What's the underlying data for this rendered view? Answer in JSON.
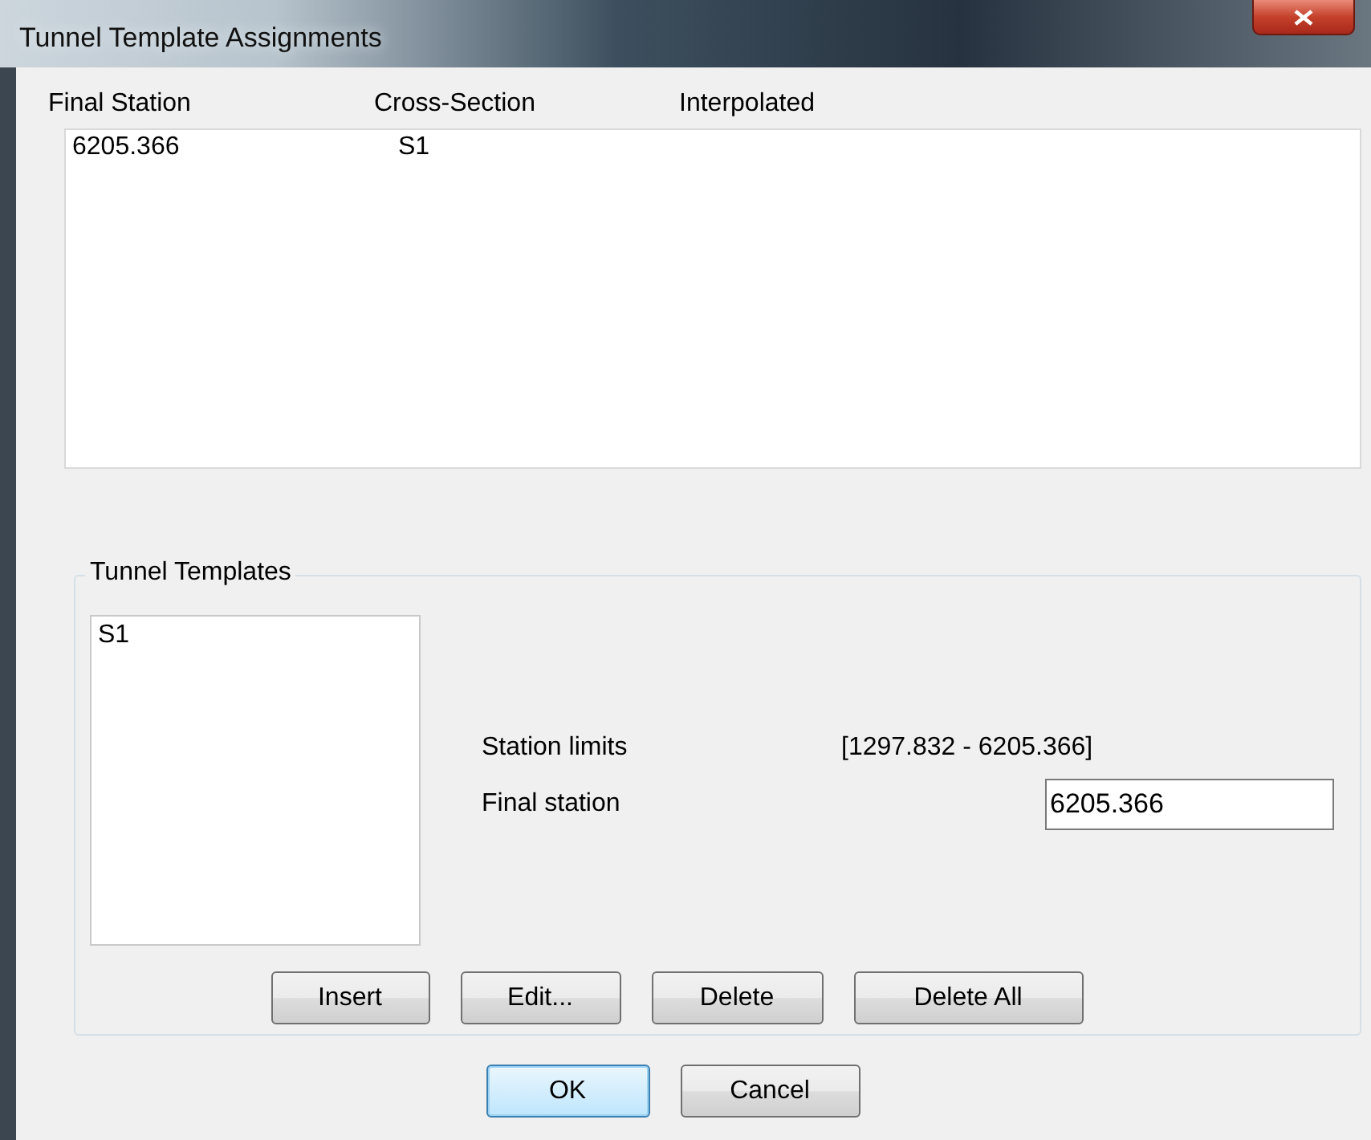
{
  "window": {
    "title": "Tunnel Template Assignments"
  },
  "assignments": {
    "columns": [
      "Final Station",
      "Cross-Section",
      "Interpolated"
    ],
    "rows": [
      {
        "cells": [
          "6205.366",
          "S1",
          ""
        ]
      }
    ]
  },
  "templates": {
    "title": "Tunnel Templates",
    "items": [
      {
        "label": "S1",
        "selected": false
      }
    ],
    "station_limits": {
      "label": "Station limits",
      "value": "[1297.832 - 6205.366]"
    },
    "final_station": {
      "label": "Final station",
      "value": "6205.366"
    },
    "buttons": [
      "Insert",
      "Edit...",
      "Delete",
      "Delete All"
    ]
  },
  "footer_buttons": [
    {
      "label": "OK",
      "default": true
    },
    {
      "label": "Cancel",
      "default": false
    }
  ]
}
